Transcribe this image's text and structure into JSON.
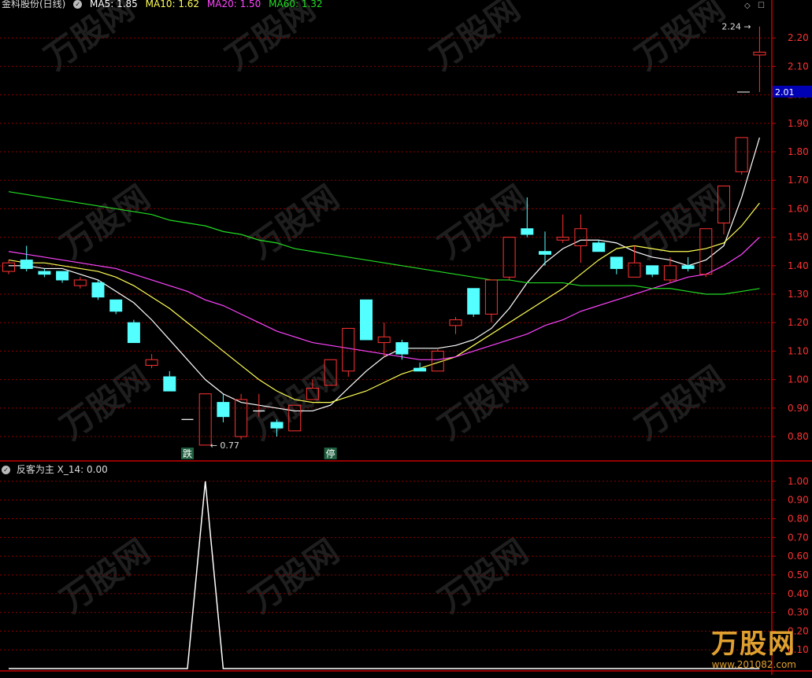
{
  "header": {
    "title": "金科股份(日线)",
    "ma5": "MA5: 1.85",
    "ma10": "MA10: 1.62",
    "ma20": "MA20: 1.50",
    "ma60": "MA60: 1.32"
  },
  "indicator_header": {
    "title": "反客为主",
    "value": "X_14: 0.00"
  },
  "annotations": {
    "low_label": "0.77",
    "high_label": "2.24",
    "current_price": "2.01",
    "die_badge": "跌",
    "ting_badge": "停"
  },
  "watermark": {
    "text": "万股网",
    "url": "www.201082.com"
  },
  "colors": {
    "up": "#ff3232",
    "down": "#54ffff",
    "ma5": "#ffffff",
    "ma10": "#ffff55",
    "ma20": "#ff44ff",
    "ma60": "#22dd22",
    "grid": "#8b0000",
    "axis": "#c80000"
  },
  "chart_data": [
    {
      "type": "candlestick",
      "title": "金科股份(日线)",
      "ylim": [
        0.72,
        2.3
      ],
      "yticks": [
        0.8,
        0.9,
        1.0,
        1.1,
        1.2,
        1.3,
        1.4,
        1.5,
        1.6,
        1.7,
        1.8,
        1.9,
        2.0,
        2.1,
        2.2
      ],
      "ytick_labels": [
        "0.80",
        "0.90",
        "1.00",
        "1.10",
        "1.20",
        "1.30",
        "1.40",
        "1.50",
        "1.60",
        "1.70",
        "1.80",
        "1.90",
        "2.00",
        "2.10",
        "2.20"
      ],
      "candles": [
        {
          "o": 1.38,
          "h": 1.42,
          "l": 1.37,
          "c": 1.41
        },
        {
          "o": 1.42,
          "h": 1.47,
          "l": 1.38,
          "c": 1.39
        },
        {
          "o": 1.38,
          "h": 1.39,
          "l": 1.36,
          "c": 1.37
        },
        {
          "o": 1.38,
          "h": 1.38,
          "l": 1.34,
          "c": 1.35
        },
        {
          "o": 1.33,
          "h": 1.36,
          "l": 1.32,
          "c": 1.35
        },
        {
          "o": 1.34,
          "h": 1.35,
          "l": 1.28,
          "c": 1.29
        },
        {
          "o": 1.28,
          "h": 1.28,
          "l": 1.23,
          "c": 1.24
        },
        {
          "o": 1.2,
          "h": 1.21,
          "l": 1.13,
          "c": 1.13
        },
        {
          "o": 1.05,
          "h": 1.09,
          "l": 1.04,
          "c": 1.07
        },
        {
          "o": 1.01,
          "h": 1.03,
          "l": 0.96,
          "c": 0.96
        },
        {
          "o": 0.86,
          "h": 0.86,
          "l": 0.86,
          "c": 0.86
        },
        {
          "o": 0.77,
          "h": 0.95,
          "l": 0.77,
          "c": 0.95
        },
        {
          "o": 0.92,
          "h": 0.95,
          "l": 0.85,
          "c": 0.87
        },
        {
          "o": 0.8,
          "h": 0.95,
          "l": 0.79,
          "c": 0.93
        },
        {
          "o": 0.89,
          "h": 0.95,
          "l": 0.87,
          "c": 0.89
        },
        {
          "o": 0.85,
          "h": 0.86,
          "l": 0.8,
          "c": 0.83
        },
        {
          "o": 0.82,
          "h": 0.91,
          "l": 0.82,
          "c": 0.91
        },
        {
          "o": 0.93,
          "h": 1.0,
          "l": 0.93,
          "c": 0.97
        },
        {
          "o": 0.98,
          "h": 1.07,
          "l": 0.98,
          "c": 1.07
        },
        {
          "o": 1.03,
          "h": 1.18,
          "l": 1.01,
          "c": 1.18
        },
        {
          "o": 1.28,
          "h": 1.28,
          "l": 1.14,
          "c": 1.14
        },
        {
          "o": 1.13,
          "h": 1.2,
          "l": 1.08,
          "c": 1.15
        },
        {
          "o": 1.13,
          "h": 1.14,
          "l": 1.07,
          "c": 1.09
        },
        {
          "o": 1.04,
          "h": 1.06,
          "l": 1.03,
          "c": 1.03
        },
        {
          "o": 1.03,
          "h": 1.11,
          "l": 1.03,
          "c": 1.1
        },
        {
          "o": 1.19,
          "h": 1.22,
          "l": 1.16,
          "c": 1.21
        },
        {
          "o": 1.32,
          "h": 1.32,
          "l": 1.22,
          "c": 1.23
        },
        {
          "o": 1.23,
          "h": 1.35,
          "l": 1.2,
          "c": 1.35
        },
        {
          "o": 1.36,
          "h": 1.5,
          "l": 1.35,
          "c": 1.5
        },
        {
          "o": 1.53,
          "h": 1.64,
          "l": 1.5,
          "c": 1.51
        },
        {
          "o": 1.45,
          "h": 1.52,
          "l": 1.4,
          "c": 1.44
        },
        {
          "o": 1.49,
          "h": 1.58,
          "l": 1.48,
          "c": 1.5
        },
        {
          "o": 1.47,
          "h": 1.58,
          "l": 1.41,
          "c": 1.53
        },
        {
          "o": 1.48,
          "h": 1.49,
          "l": 1.45,
          "c": 1.45
        },
        {
          "o": 1.43,
          "h": 1.43,
          "l": 1.37,
          "c": 1.39
        },
        {
          "o": 1.36,
          "h": 1.47,
          "l": 1.36,
          "c": 1.41
        },
        {
          "o": 1.4,
          "h": 1.4,
          "l": 1.36,
          "c": 1.37
        },
        {
          "o": 1.35,
          "h": 1.43,
          "l": 1.34,
          "c": 1.4
        },
        {
          "o": 1.4,
          "h": 1.43,
          "l": 1.38,
          "c": 1.39
        },
        {
          "o": 1.37,
          "h": 1.53,
          "l": 1.36,
          "c": 1.53
        },
        {
          "o": 1.55,
          "h": 1.68,
          "l": 1.51,
          "c": 1.68
        },
        {
          "o": 1.73,
          "h": 1.85,
          "l": 1.72,
          "c": 1.85
        },
        {
          "o": 2.14,
          "h": 2.24,
          "l": 2.01,
          "c": 2.15
        }
      ],
      "ma": [
        {
          "name": "MA5",
          "values": [
            1.4,
            1.4,
            1.39,
            1.39,
            1.37,
            1.35,
            1.31,
            1.27,
            1.21,
            1.14,
            1.07,
            1.0,
            0.95,
            0.92,
            0.91,
            0.9,
            0.89,
            0.89,
            0.91,
            0.97,
            1.03,
            1.08,
            1.11,
            1.11,
            1.11,
            1.12,
            1.14,
            1.18,
            1.25,
            1.34,
            1.41,
            1.46,
            1.49,
            1.49,
            1.48,
            1.45,
            1.43,
            1.42,
            1.4,
            1.42,
            1.47,
            1.64,
            1.85
          ]
        },
        {
          "name": "MA10",
          "values": [
            1.42,
            1.41,
            1.41,
            1.4,
            1.39,
            1.38,
            1.36,
            1.33,
            1.29,
            1.25,
            1.2,
            1.15,
            1.1,
            1.05,
            1.0,
            0.96,
            0.93,
            0.92,
            0.92,
            0.94,
            0.96,
            0.99,
            1.02,
            1.04,
            1.06,
            1.08,
            1.12,
            1.16,
            1.2,
            1.24,
            1.28,
            1.32,
            1.37,
            1.42,
            1.46,
            1.47,
            1.46,
            1.45,
            1.45,
            1.46,
            1.48,
            1.54,
            1.62
          ]
        },
        {
          "name": "MA20",
          "values": [
            1.45,
            1.44,
            1.43,
            1.42,
            1.41,
            1.4,
            1.39,
            1.37,
            1.35,
            1.33,
            1.31,
            1.28,
            1.26,
            1.23,
            1.2,
            1.17,
            1.15,
            1.13,
            1.12,
            1.11,
            1.1,
            1.09,
            1.08,
            1.07,
            1.07,
            1.08,
            1.1,
            1.12,
            1.14,
            1.16,
            1.19,
            1.21,
            1.24,
            1.26,
            1.28,
            1.3,
            1.32,
            1.34,
            1.36,
            1.37,
            1.4,
            1.44,
            1.5
          ]
        },
        {
          "name": "MA60",
          "values": [
            1.66,
            1.65,
            1.64,
            1.63,
            1.62,
            1.61,
            1.6,
            1.59,
            1.58,
            1.56,
            1.55,
            1.54,
            1.52,
            1.51,
            1.49,
            1.48,
            1.46,
            1.45,
            1.44,
            1.43,
            1.42,
            1.41,
            1.4,
            1.39,
            1.38,
            1.37,
            1.36,
            1.35,
            1.35,
            1.34,
            1.34,
            1.34,
            1.33,
            1.33,
            1.33,
            1.33,
            1.32,
            1.32,
            1.31,
            1.3,
            1.3,
            1.31,
            1.32
          ]
        }
      ]
    },
    {
      "type": "line",
      "title": "反客为主",
      "ylim": [
        0,
        1.05
      ],
      "yticks": [
        0.1,
        0.2,
        0.3,
        0.4,
        0.5,
        0.6,
        0.7,
        0.8,
        0.9,
        1.0
      ],
      "ytick_labels": [
        "0.10",
        "0.20",
        "0.30",
        "0.40",
        "0.50",
        "0.60",
        "0.70",
        "0.80",
        "0.90",
        "1.00"
      ],
      "series": [
        {
          "name": "X_14",
          "values": [
            0,
            0,
            0,
            0,
            0,
            0,
            0,
            0,
            0,
            0,
            0,
            1,
            0,
            0,
            0,
            0,
            0,
            0,
            0,
            0,
            0,
            0,
            0,
            0,
            0,
            0,
            0,
            0,
            0,
            0,
            0,
            0,
            0,
            0,
            0,
            0,
            0,
            0,
            0,
            0,
            0,
            0,
            0
          ]
        }
      ]
    }
  ]
}
